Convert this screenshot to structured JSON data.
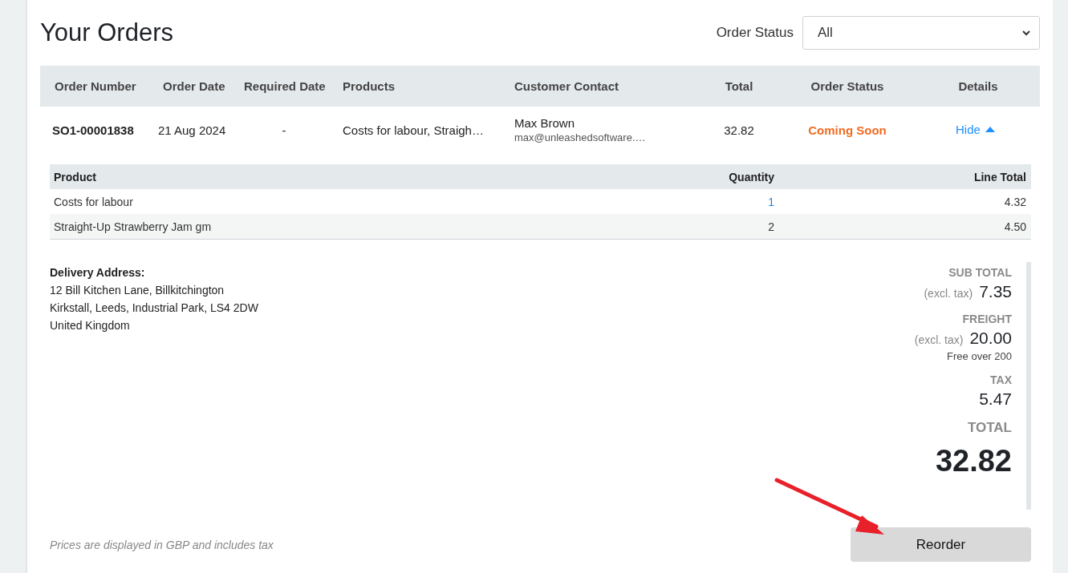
{
  "title": "Your Orders",
  "filter": {
    "label": "Order Status",
    "value": "All"
  },
  "columns": [
    "Order Number",
    "Order Date",
    "Required Date",
    "Products",
    "Customer Contact",
    "Total",
    "Order Status",
    "Details"
  ],
  "orders": [
    {
      "number": "SO1-00001838",
      "order_date": "21 Aug 2024",
      "required_date": "-",
      "products": "Costs for labour, Straigh…",
      "contact_name": "Max Brown",
      "contact_email": "max@unleashedsoftware.…",
      "total": "32.82",
      "status": "Coming Soon",
      "details_link": "Hide",
      "expanded": true,
      "line_columns": [
        "Product",
        "Quantity",
        "Line Total"
      ],
      "lines": [
        {
          "product": "Costs for labour",
          "quantity": "1",
          "line_total": "4.32",
          "quantity_link": true
        },
        {
          "product": "Straight-Up Strawberry Jam gm",
          "quantity": "2",
          "line_total": "4.50",
          "quantity_link": false
        }
      ],
      "address_label": "Delivery Address:",
      "address_lines": [
        "12 Bill Kitchen Lane, Billkitchington",
        "Kirkstall, Leeds, Industrial Park, LS4 2DW",
        "United Kingdom"
      ],
      "summary": [
        {
          "label": "SUB TOTAL",
          "note": "(excl. tax)",
          "value": "7.35",
          "kind": "normal"
        },
        {
          "label": "FREIGHT",
          "note": "(excl. tax)",
          "value": "20.00",
          "sub": "Free over 200",
          "kind": "normal"
        },
        {
          "label": "TAX",
          "value": "5.47",
          "kind": "normal"
        },
        {
          "label": "TOTAL",
          "value": "32.82",
          "kind": "grand"
        }
      ],
      "price_note": "Prices are displayed in GBP and includes tax",
      "reorder_button": "Reorder"
    }
  ]
}
